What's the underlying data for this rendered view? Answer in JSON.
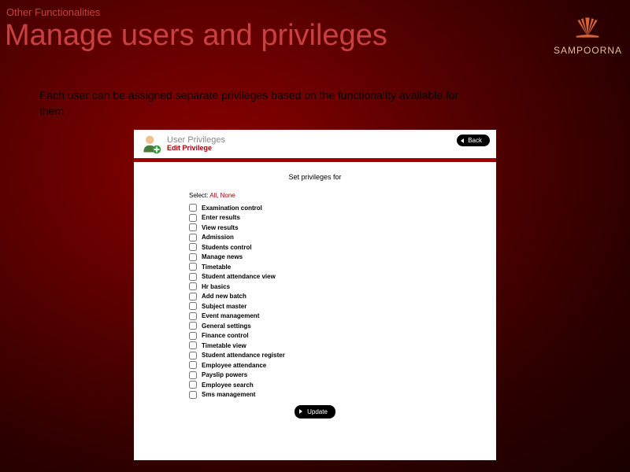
{
  "breadcrumb": "Other Functionalities",
  "title": "Manage users and privileges",
  "description": "Each user can be assigned separate privileges based on the functionality available for them",
  "logo": {
    "text": "SAMPOORNA"
  },
  "panel": {
    "title_main": "User Privileges",
    "title_sub": "Edit Privilege",
    "back_label": "Back",
    "set_label": "Set privileges for",
    "select_label": "Select:",
    "select_all": "All",
    "select_sep": ", ",
    "select_none": "None",
    "update_label": "Update",
    "privileges": [
      "Examination control",
      "Enter results",
      "View results",
      "Admission",
      "Students control",
      "Manage news",
      "Timetable",
      "Student attendance view",
      "Hr basics",
      "Add new batch",
      "Subject master",
      "Event management",
      "General settings",
      "Finance control",
      "Timetable view",
      "Student attendance register",
      "Employee attendance",
      "Payslip powers",
      "Employee search",
      "Sms management"
    ]
  }
}
